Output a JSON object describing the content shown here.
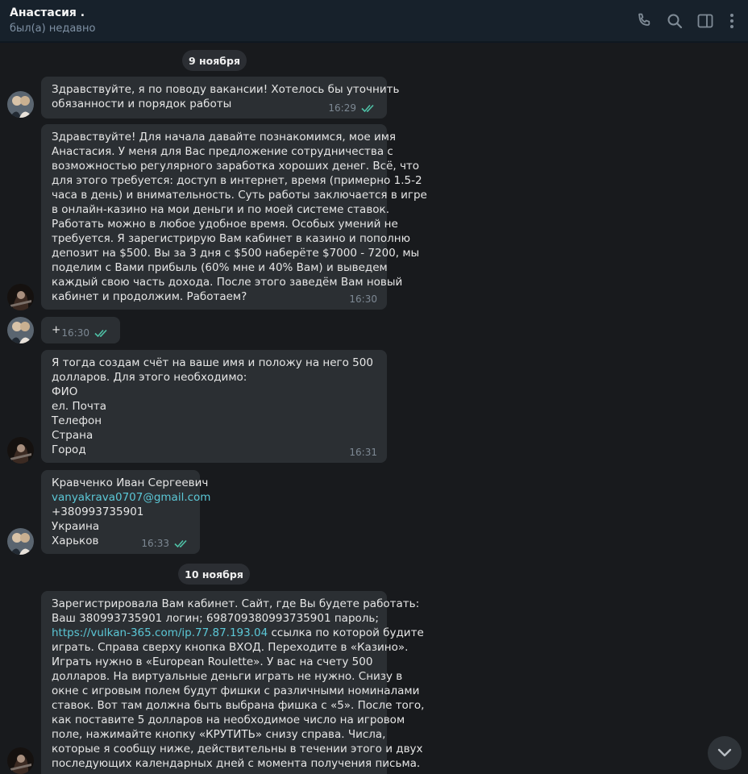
{
  "header": {
    "name": "Анастасия .",
    "status": "был(а) недавно",
    "icons": [
      "phone-icon",
      "search-icon",
      "sidebar-toggle-icon",
      "more-vertical-icon"
    ]
  },
  "dates": {
    "d1": "9 ноября",
    "d2": "10 ноября"
  },
  "messages": [
    {
      "lines": [
        "Здравствуйте, я по поводу вакансии! Хотелось бы уточнить",
        "обязанности и порядок работы"
      ],
      "time": "16:29",
      "read": true
    },
    {
      "lines": [
        "Здравствуйте! Для начала давайте познакомимся, мое имя",
        "Анастасия. У меня для Вас предложение сотрудничества с",
        "возможностью регулярного заработка хороших денег. Всё, что",
        "для этого требуется: доступ в интернет, время (примерно 1.5-2",
        "часа в день) и внимательность. Суть работы заключается в игре",
        "в онлайн-казино на мои деньги и по моей системе ставок.",
        "Работать можно в любое удобное время. Особых умений не",
        "требуется. Я зарегистрирую Вам кабинет в казино и пополню",
        "депозит на $500. Вы за 3 дня с $500 наберёте $7000 - 7200, мы",
        "поделим с Вами прибыль (60% мне и 40% Вам) и выведем",
        "каждый свою часть дохода. После этого заведём Вам новый",
        "кабинет и продолжим. Работаем?"
      ],
      "time": "16:30",
      "read": false
    },
    {
      "lines": [
        "+"
      ],
      "time": "16:30",
      "read": true
    },
    {
      "lines": [
        "Я тогда создам  счёт на ваше имя  и положу на него 500",
        "долларов.  Для этого необходимо:",
        "ФИО",
        "ел. Почта",
        "Телефон",
        "Страна",
        "Город"
      ],
      "time": "16:31",
      "read": false
    },
    {
      "lines": [
        "Кравченко Иван Сергеевич",
        "vanyakrava0707@gmail.com",
        "+380993735901",
        "Украина",
        "Харьков"
      ],
      "time": "16:33",
      "read": true
    },
    {
      "lines": [
        "Зарегистрировала Вам кабинет. Сайт, где Вы будете работать:",
        "Ваш 380993735901 логин; 698709380993735901 пароль;",
        "ссылка по которой будите",
        "играть. Справа сверху кнопка ВХОД. Переходите в «Казино».",
        "Играть нужно в «European Roulette». У вас на счету 500",
        "долларов. На виртуальные деньги играть не нужно. Снизу в",
        "окне с игровым полем будут фишки с различными номиналами",
        "ставок. Вот там должна быть выбрана фишка с «5». После того,",
        "как поставите 5 долларов на необходимое число на игровом",
        "поле, нажимайте кнопку «КРУТИТЬ» снизу справа. Числа,",
        "которые я сообщу ниже, действительны в течении этого и двух",
        "последующих календарных дней с момента получения письма."
      ],
      "link": "https://vulkan-365.com/ip.77.87.193.04"
    }
  ],
  "colors": {
    "bubble": "#2b2f33",
    "link": "#5bc7d6",
    "check": "#4fc1a6",
    "background": "#181a1d"
  }
}
